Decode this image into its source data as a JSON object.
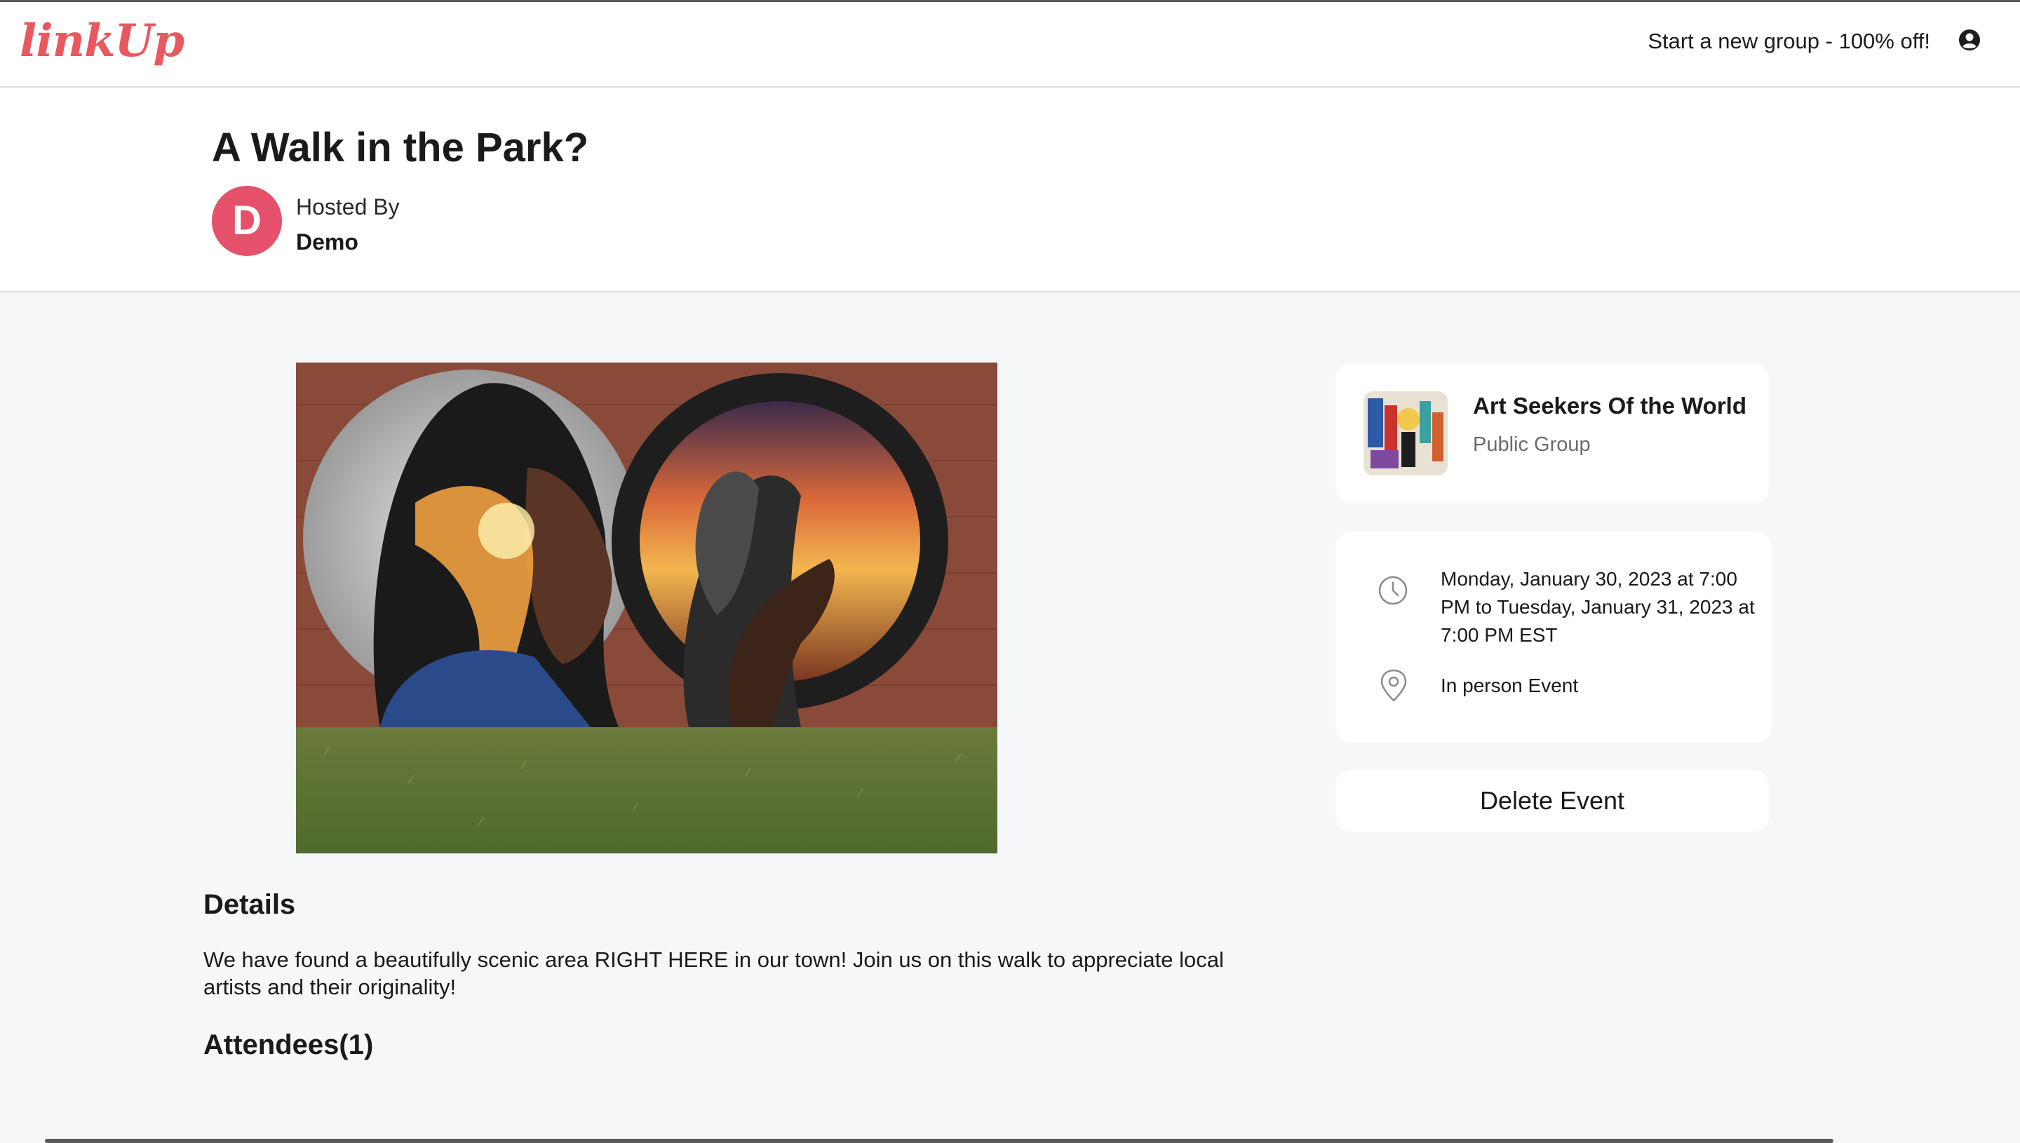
{
  "header": {
    "logo_text": "linkUp",
    "promo_link": "Start a new group - 100% off!",
    "user_icon": "user-circle-icon"
  },
  "event": {
    "title": "A Walk in the Park?",
    "hosted_by_label": "Hosted By",
    "host_name": "Demo",
    "host_initial": "D",
    "image_icon": "mural-image"
  },
  "details": {
    "heading": "Details",
    "text": "We have found a beautifully scenic area RIGHT HERE in our town! Join us on this walk to appreciate local artists and their originality!"
  },
  "attendees": {
    "heading": "Attendees(1)"
  },
  "group_card": {
    "name": "Art Seekers Of the World",
    "type": "Public Group"
  },
  "info_card": {
    "datetime": "Monday, January 30, 2023 at 7:00 PM to Tuesday, January 31, 2023 at 7:00 PM EST",
    "location": "In person Event",
    "clock_icon": "clock-icon",
    "pin_icon": "location-pin-icon"
  },
  "actions": {
    "delete_label": "Delete Event"
  },
  "colors": {
    "brand": "#e8595f",
    "avatar": "#e5506a",
    "page_bg": "#f6f7f8",
    "card_bg": "#ffffff"
  }
}
